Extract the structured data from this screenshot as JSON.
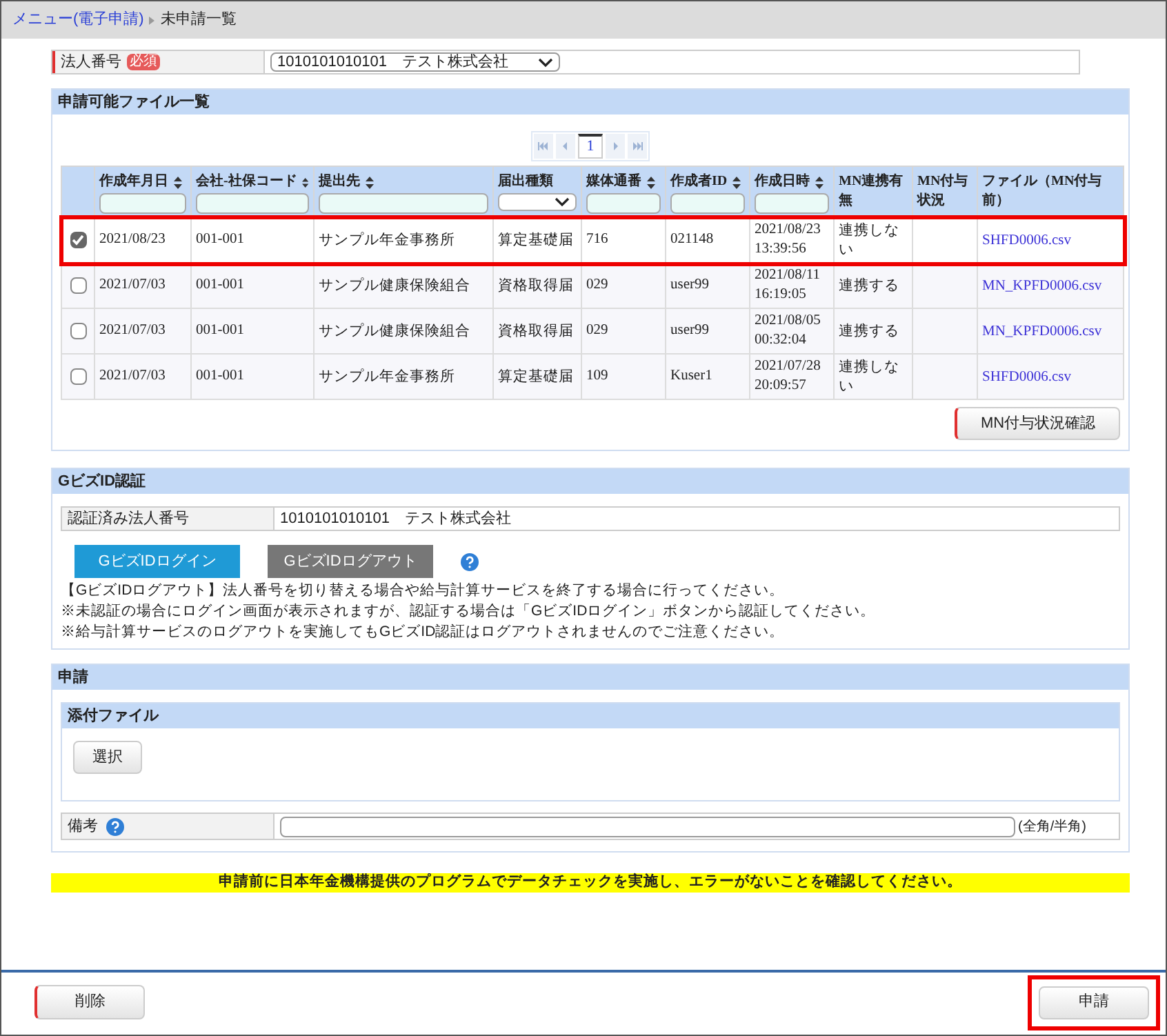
{
  "breadcrumb": {
    "link": "メニュー(電子申請)",
    "current": "未申請一覧"
  },
  "corp": {
    "label": "法人番号",
    "badge": "必須",
    "value": "1010101010101　テスト株式会社"
  },
  "files": {
    "title": "申請可能ファイル一覧",
    "page": "1",
    "columns": [
      {
        "label": "作成年月日",
        "sortable": true,
        "kind": "text"
      },
      {
        "label": "会社-社保コード",
        "sortable": true,
        "kind": "text"
      },
      {
        "label": "提出先",
        "sortable": true,
        "kind": "text"
      },
      {
        "label": "届出種類",
        "sortable": false,
        "kind": "select"
      },
      {
        "label": "媒体通番",
        "sortable": true,
        "kind": "text"
      },
      {
        "label": "作成者ID",
        "sortable": true,
        "kind": "text"
      },
      {
        "label": "作成日時",
        "sortable": true,
        "kind": "text"
      },
      {
        "label": "MN連携有無",
        "sortable": false,
        "kind": "plain"
      },
      {
        "label": "MN付与状況",
        "sortable": false,
        "kind": "plain"
      },
      {
        "label": "ファイル（MN付与前）",
        "sortable": false,
        "kind": "plain"
      }
    ],
    "rows": [
      {
        "checked": true,
        "highlighted": true,
        "cells": [
          "2021/08/23",
          "001-001",
          "サンプル年金事務所",
          "算定基礎届",
          "716",
          "021148",
          "2021/08/23 13:39:56",
          "連携しない"
        ],
        "file": "SHFD0006.csv"
      },
      {
        "checked": false,
        "highlighted": false,
        "cells": [
          "2021/07/03",
          "001-001",
          "サンプル健康保険組合",
          "資格取得届",
          "029",
          "user99",
          "2021/08/11 16:19:05",
          "連携する"
        ],
        "file": "MN_KPFD0006.csv"
      },
      {
        "checked": false,
        "highlighted": false,
        "cells": [
          "2021/07/03",
          "001-001",
          "サンプル健康保険組合",
          "資格取得届",
          "029",
          "user99",
          "2021/08/05 00:32:04",
          "連携する"
        ],
        "file": "MN_KPFD0006.csv"
      },
      {
        "checked": false,
        "highlighted": false,
        "cells": [
          "2021/07/03",
          "001-001",
          "サンプル年金事務所",
          "算定基礎届",
          "109",
          "Kuser1",
          "2021/07/28 20:09:57",
          "連携しない"
        ],
        "file": "SHFD0006.csv"
      }
    ],
    "button": "MN付与状況確認"
  },
  "gbiz": {
    "title": "GビズID認証",
    "label": "認証済み法人番号",
    "value": "1010101010101　テスト株式会社",
    "login": "GビズIDログイン",
    "logout": "GビズIDログアウト",
    "notes": [
      "【GビズIDログアウト】法人番号を切り替える場合や給与計算サービスを終了する場合に行ってください。",
      "※未認証の場合にログイン画面が表示されますが、認証する場合は「GビズIDログイン」ボタンから認証してください。",
      "※給与計算サービスのログアウトを実施してもGビズID認証はログアウトされませんのでご注意ください。"
    ]
  },
  "apply": {
    "title": "申請",
    "attach_title": "添付ファイル",
    "select": "選択",
    "remarks_label": "備考",
    "remarks_hint": "(全角/半角)"
  },
  "warning": "申請前に日本年金機構提供のプログラムでデータチェックを実施し、エラーがないことを確認してください。",
  "footer": {
    "delete": "削除",
    "submit": {
      "label": "申請",
      "highlighted": true
    }
  }
}
